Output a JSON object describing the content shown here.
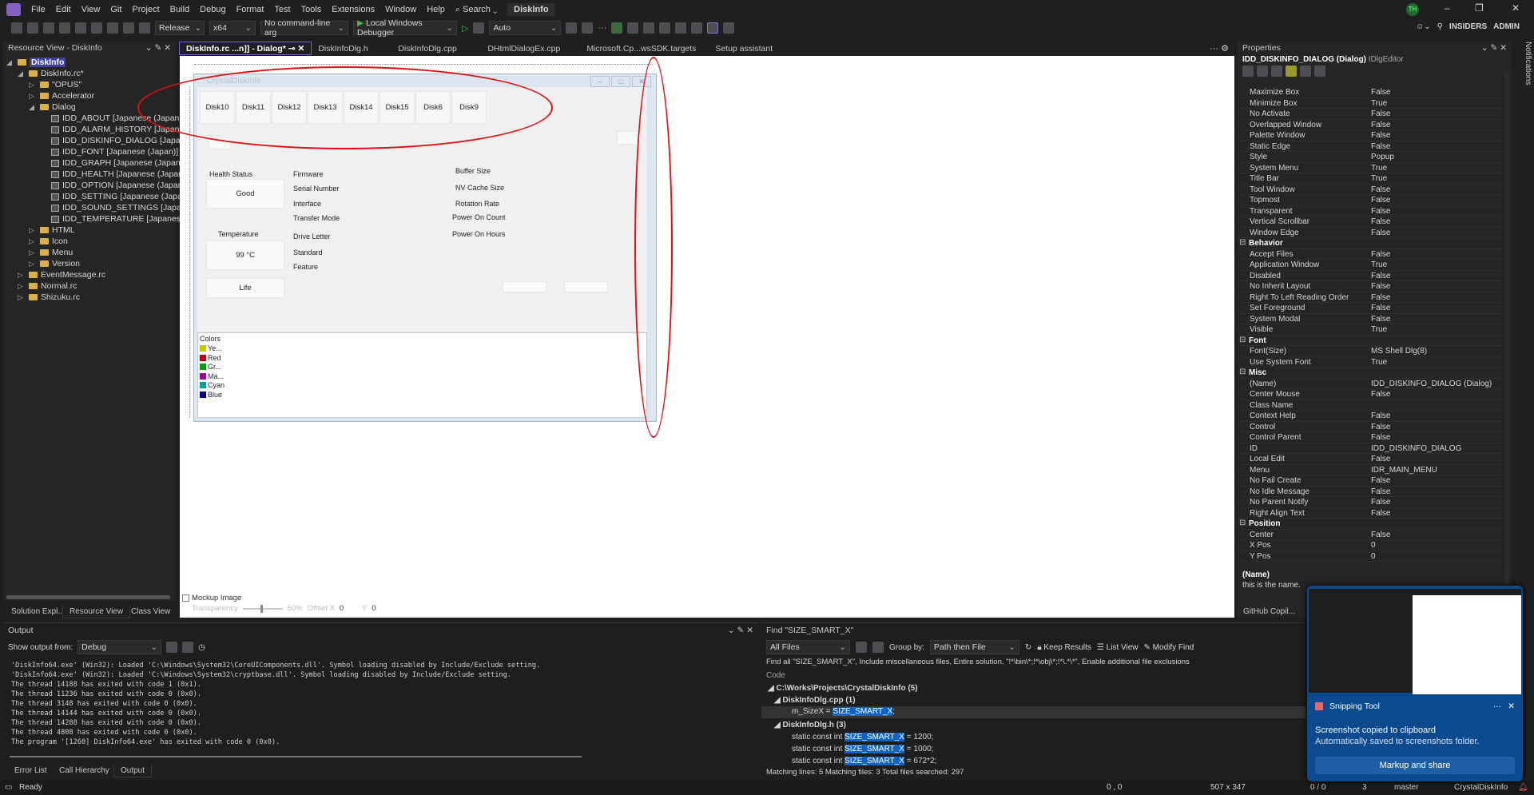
{
  "menubar": {
    "items": [
      "File",
      "Edit",
      "View",
      "Git",
      "Project",
      "Build",
      "Debug",
      "Format",
      "Test",
      "Tools",
      "Extensions",
      "Window",
      "Help",
      "Search"
    ],
    "solution": "DiskInfo",
    "avatar": "TH",
    "insiders": "INSIDERS",
    "admin": "ADMIN"
  },
  "toolbar": {
    "config": "Release",
    "platform": "x64",
    "args": "No command-line arg",
    "debugger": "Local Windows Debugger",
    "auto": "Auto"
  },
  "left_panel": {
    "title": "Resource View - DiskInfo",
    "tree": [
      "DiskInfo",
      "DiskInfo.rc*",
      "\"OPUS\"",
      "Accelerator",
      "Dialog",
      "IDD_ABOUT [Japanese (Japan)]",
      "IDD_ALARM_HISTORY [Japanese (J",
      "IDD_DISKINFO_DIALOG [Japanese (",
      "IDD_FONT [Japanese (Japan)]",
      "IDD_GRAPH [Japanese (Japan)]",
      "IDD_HEALTH [Japanese (Japan)]",
      "IDD_OPTION [Japanese (Japan)]",
      "IDD_SETTING [Japanese (Japan)]",
      "IDD_SOUND_SETTINGS [Japanese (J",
      "IDD_TEMPERATURE [Japanese (Japa",
      "HTML",
      "Icon",
      "Menu",
      "Version",
      "EventMessage.rc",
      "Normal.rc",
      "Shizuku.rc"
    ],
    "tabs": [
      "Solution Expl...",
      "Resource View",
      "Class View"
    ]
  },
  "doc_tabs": [
    "DiskInfo.rc ...n]] - Dialog*",
    "DiskInfoDlg.h",
    "DiskInfoDlg.cpp",
    "DHtmlDialogEx.cpp",
    "Microsoft.Cp...wsSDK.targets",
    "Setup assistant"
  ],
  "dialog": {
    "title": "CrystalDiskInfo",
    "disks": [
      "Disk10",
      "Disk11",
      "Disk12",
      "Disk13",
      "Disk14",
      "Disk15",
      "Disk6",
      "Disk9"
    ],
    "health_label": "Health Status",
    "health_value": "Good",
    "temp_label": "Temperature",
    "temp_value": "99 °C",
    "life": "Life",
    "mid_labels": [
      "Firmware",
      "Serial Number",
      "Interface",
      "Transfer Mode",
      "Drive Letter",
      "Standard",
      "Feature"
    ],
    "right_labels": [
      "Buffer Size",
      "NV Cache Size",
      "Rotation Rate",
      "Power On Count",
      "Power On Hours"
    ],
    "colors_title": "Colors",
    "colors": [
      {
        "label": "Ye...",
        "color": "#c8c800"
      },
      {
        "label": "Red",
        "color": "#c00000"
      },
      {
        "label": "Gr...",
        "color": "#00a000"
      },
      {
        "label": "Ma...",
        "color": "#a000a0"
      },
      {
        "label": "Cyan",
        "color": "#00a0a0"
      },
      {
        "label": "Blue",
        "color": "#000090"
      }
    ]
  },
  "mockup": {
    "label": "Mockup Image",
    "transparency": "Transparency",
    "percent": "50%",
    "offset_x": "Offset X",
    "x": "0",
    "y_label": "Y",
    "y": "0"
  },
  "properties": {
    "title": "Properties",
    "object": "IDD_DISKINFO_DIALOG (Dialog)",
    "editor": "IDlgEditor",
    "rows": [
      [
        "Maximize Box",
        "False"
      ],
      [
        "Minimize Box",
        "True"
      ],
      [
        "No Activate",
        "False"
      ],
      [
        "Overlapped Window",
        "False"
      ],
      [
        "Palette Window",
        "False"
      ],
      [
        "Static Edge",
        "False"
      ],
      [
        "Style",
        "Popup"
      ],
      [
        "System Menu",
        "True"
      ],
      [
        "Title Bar",
        "True"
      ],
      [
        "Tool Window",
        "False"
      ],
      [
        "Topmost",
        "False"
      ],
      [
        "Transparent",
        "False"
      ],
      [
        "Vertical Scrollbar",
        "False"
      ],
      [
        "Window Edge",
        "False"
      ],
      [
        "Behavior",
        null
      ],
      [
        "Accept Files",
        "False"
      ],
      [
        "Application Window",
        "True"
      ],
      [
        "Disabled",
        "False"
      ],
      [
        "No Inherit Layout",
        "False"
      ],
      [
        "Right To Left Reading Order",
        "False"
      ],
      [
        "Set Foreground",
        "False"
      ],
      [
        "System Modal",
        "False"
      ],
      [
        "Visible",
        "True"
      ],
      [
        "Font",
        null
      ],
      [
        "Font(Size)",
        "MS Shell Dlg(8)"
      ],
      [
        "Use System Font",
        "True"
      ],
      [
        "Misc",
        null
      ],
      [
        "(Name)",
        "IDD_DISKINFO_DIALOG (Dialog)"
      ],
      [
        "Center Mouse",
        "False"
      ],
      [
        "Class Name",
        ""
      ],
      [
        "Context Help",
        "False"
      ],
      [
        "Control",
        "False"
      ],
      [
        "Control Parent",
        "False"
      ],
      [
        "ID",
        "IDD_DISKINFO_DIALOG"
      ],
      [
        "Local Edit",
        "False"
      ],
      [
        "Menu",
        "IDR_MAIN_MENU"
      ],
      [
        "No Fail Create",
        "False"
      ],
      [
        "No Idle Message",
        "False"
      ],
      [
        "No Parent Notify",
        "False"
      ],
      [
        "Right Align Text",
        "False"
      ],
      [
        "Position",
        null
      ],
      [
        "Center",
        "False"
      ],
      [
        "X Pos",
        "0"
      ],
      [
        "Y Pos",
        "0"
      ]
    ],
    "desc_title": "(Name)",
    "desc": "this is the name.",
    "copilot_tab": "GitHub Copil..."
  },
  "notifications_label": "Notifications",
  "output": {
    "title": "Output",
    "show_from": "Show output from:",
    "source": "Debug",
    "lines": [
      "'DiskInfo64.exe' (Win32): Loaded 'C:\\Windows\\System32\\CoreUIComponents.dll'. Symbol loading disabled by Include/Exclude setting.",
      "'DiskInfo64.exe' (Win32): Loaded 'C:\\Windows\\System32\\cryptbase.dll'. Symbol loading disabled by Include/Exclude setting.",
      "The thread 14188 has exited with code 1 (0x1).",
      "The thread 11236 has exited with code 0 (0x0).",
      "The thread 3148 has exited with code 0 (0x0).",
      "The thread 14144 has exited with code 0 (0x0).",
      "The thread 14288 has exited with code 0 (0x0).",
      "The thread 4808 has exited with code 0 (0x0).",
      "The program '[1260] DiskInfo64.exe' has exited with code 0 (0x0)."
    ],
    "tabs": [
      "Error List",
      "Call Hierarchy",
      "Output"
    ]
  },
  "find": {
    "title": "Find \"SIZE_SMART_X\"",
    "scope": "All Files",
    "group_by": "Group by:",
    "group_value": "Path then File",
    "keep": "Keep Results",
    "list_view": "List View",
    "modify": "Modify Find",
    "summary": "Find all \"SIZE_SMART_X\", Include miscellaneous files, Entire solution, \"!*\\bin\\*;!*\\obj\\*;!*\\.*\\*\", Enable additional file exclusions",
    "code_header": "Code",
    "root": "C:\\Works\\Projects\\CrystalDiskInfo  (5)",
    "file1": "DiskInfoDlg.cpp  (1)",
    "r1_pre": "m_SizeX = ",
    "match": "SIZE_SMART_X",
    "r1_post": ";",
    "file2": "DiskInfoDlg.h  (3)",
    "r_pre": "static const int ",
    "r2_post": " = 1200;",
    "r3_post": " = 1000;",
    "r4_post": " = 672*2;",
    "footer": "Matching lines: 5 Matching files: 3 Total files searched: 297"
  },
  "status": {
    "ready": "Ready",
    "pos": "0 , 0",
    "size": "507 x 347",
    "sync": "0 / 0",
    "changes": "3",
    "branch": "master",
    "repo": "CrystalDiskInfo"
  },
  "toast": {
    "app": "Snipping Tool",
    "title": "Screenshot copied to clipboard",
    "body": "Automatically saved to screenshots folder.",
    "action": "Markup and share"
  }
}
